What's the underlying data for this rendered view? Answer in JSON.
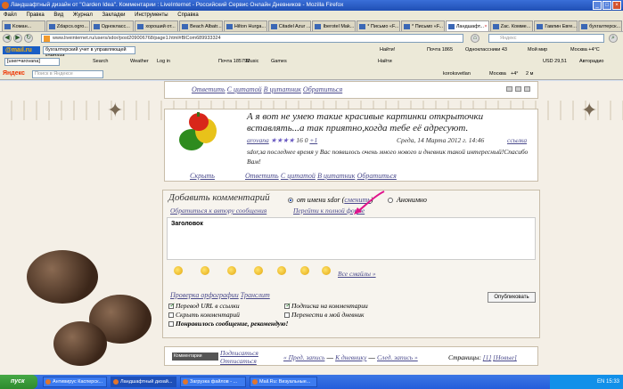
{
  "window": {
    "title": "Ландшафтный дизайн от \"Garden Idea\". Комментарии : LiveInternet - Российский Сервис Онлайн Дневников - Mozilla Firefox",
    "minimize": "_",
    "maximize": "□",
    "close": "×"
  },
  "menu": [
    "Файл",
    "Правка",
    "Вид",
    "Журнал",
    "Закладки",
    "Инструменты",
    "Справка"
  ],
  "tabs": [
    {
      "label": "Koмaн..."
    },
    {
      "label": "Zdapcs.ogro..."
    },
    {
      "label": "Однокласс..."
    },
    {
      "label": "хороший от..."
    },
    {
      "label": "Beach Albatr..."
    },
    {
      "label": "Hilton Hurga..."
    },
    {
      "label": "Citadel Azur ..."
    },
    {
      "label": "Iberotel Mak..."
    },
    {
      "label": "* Письмо «F..."
    },
    {
      "label": "* Письмо «F..."
    },
    {
      "label": "Ландшафт..."
    },
    {
      "label": "Zac. Комме..."
    },
    {
      "label": "Гавлин Евге..."
    },
    {
      "label": "бухгалтерск..."
    }
  ],
  "nav": {
    "url": "www.liveinternet.ru/users/sdor/post209006768/page1.html#BlCom689933324",
    "search_placeholder": "Яндекс"
  },
  "mailbar": {
    "logo": "@mail.ru",
    "select_value": "бухгалтерский учет в управляющей компани",
    "find": "Найти!",
    "mail": "Почта 1865",
    "odnoklassniki": "Одноклассники 43",
    "moimir": "Мой мир",
    "weather": "Москва +4°C"
  },
  "bar2": {
    "select_value": "[user=arovana]",
    "search": "Search",
    "weather": "Weather",
    "facebook": "Log in",
    "music": "Music",
    "games": "Games",
    "mail": "Почта 185792",
    "find": "Найти",
    "usd": "USD 29,51",
    "auto": "Авторадио"
  },
  "bar3": {
    "logo": "Яндекс",
    "search_placeholder": "Поиск в Яндексе",
    "koroksvetlan": "koroksvetlan",
    "city": "Москва",
    "temp": "+4°",
    "pm": "2 м"
  },
  "top_comment_links": {
    "answer": "Ответить",
    "quote": "С цитатой",
    "to_quote": "В цитатник",
    "reply": "Обратиться"
  },
  "comment": {
    "text": "А я вот не умею такие красивые картинки открыточки вставлять...а так приятно,когда тебе её адресуют.",
    "author": "arovana",
    "stars": "★★★★",
    "rating_count": "16",
    "rating_zero": "0",
    "rating_plus": "+1",
    "date": "Среда, 14 Марта 2012 г. 14:46",
    "ref_label": "ссылка",
    "body": "sdor,за последнее время у Вас появилось очень много нового и дневник такой интересный!Спасибо Вам!",
    "hide": "Скрыть",
    "answer": "Ответить",
    "quote": "С цитатой",
    "to_quote": "В цитатник",
    "reply": "Обратиться"
  },
  "add_comment": {
    "title": "Добавить комментарий",
    "option_author": "от имени sdor",
    "option_change": "сменить",
    "option_anon": "Анонимно",
    "link_author": "Обратиться к автору сообщения",
    "link_full": "Перейти к полной форме",
    "subject_label": "Заголовок",
    "all_smileys": "Все смайлы »",
    "spell_check": "Проверка орфографии",
    "translit": "Транслит",
    "publish": "Опубликовать",
    "cb_url": "Перевод URL в ссылки",
    "cb_subscribe": "Подписка на комментарии",
    "cb_hide": "Скрыть комментарий",
    "cb_move": "Перенести в мой дневник",
    "cb_like": "Понравилось сообщение, рекомендую!"
  },
  "footer": {
    "tag": "Комментарии",
    "subscribe": "Подписаться",
    "unsubscribe": "Отписаться",
    "prev": "« Пред. запись",
    "diary": "К дневнику",
    "next": "След. запись »",
    "pages_label": "Страницы:",
    "page1": "[1]",
    "new": "[Новые]"
  },
  "taskbar": {
    "start": "пуск",
    "tasks": [
      "Антивирус Касперск...",
      "Ландшафтный дизай...",
      "Загрузка файлов - ...",
      "Mail.Ru: Визуальные..."
    ],
    "lang": "EN",
    "time": "15:33"
  },
  "colors": {
    "link": "#4a4a8c",
    "page_bg": "#f4efe6",
    "arrow": "#e0148c"
  }
}
